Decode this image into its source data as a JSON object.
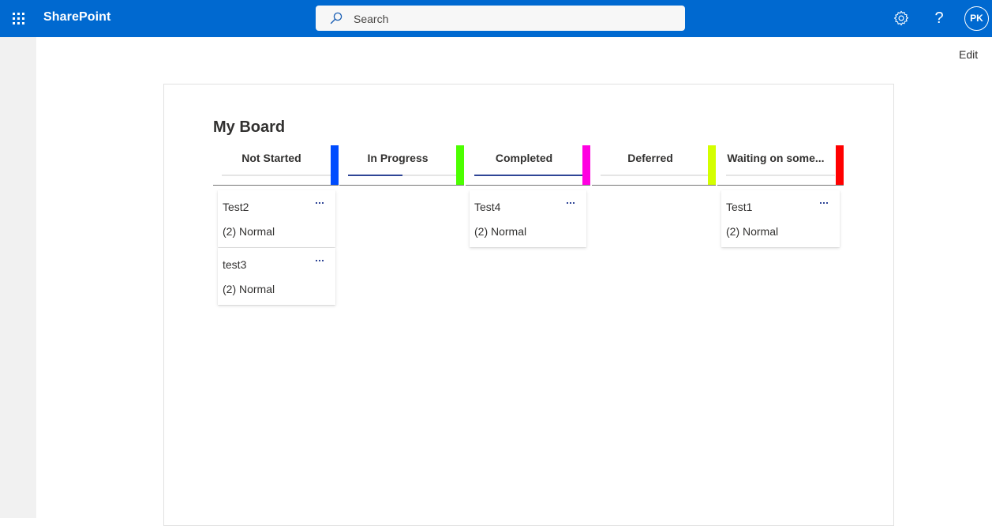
{
  "suitebar": {
    "app_name": "SharePoint",
    "search_placeholder": "Search",
    "waffle_icon": "app-launcher-icon",
    "settings_icon": "gear-icon",
    "help_label": "?",
    "avatar_initials": "PK",
    "brand_color": "#0069d0"
  },
  "page": {
    "edit_label": "Edit"
  },
  "board": {
    "title": "My Board",
    "columns": [
      {
        "label": "Not Started",
        "color": "#004cff",
        "progress": 0,
        "cards": [
          {
            "title": "Test2",
            "priority": "(2) Normal"
          },
          {
            "title": "test3",
            "priority": "(2) Normal"
          }
        ]
      },
      {
        "label": "In Progress",
        "color": "#4cff00",
        "progress": 0.5,
        "cards": []
      },
      {
        "label": "Completed",
        "color": "#ff00e1",
        "progress": 1,
        "cards": [
          {
            "title": "Test4",
            "priority": "(2) Normal"
          }
        ]
      },
      {
        "label": "Deferred",
        "color": "#d4ff00",
        "progress": 0,
        "cards": []
      },
      {
        "label": "Waiting on some...",
        "color": "#ff0000",
        "progress": 0,
        "cards": [
          {
            "title": "Test1",
            "priority": "(2) Normal"
          }
        ]
      }
    ],
    "more_icon": "more-options-icon",
    "progress_color": "#2f4596"
  }
}
